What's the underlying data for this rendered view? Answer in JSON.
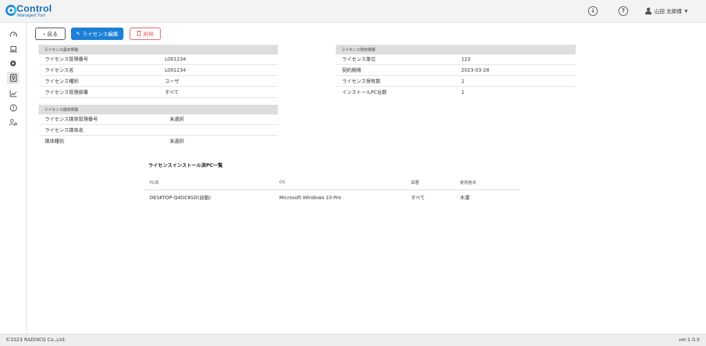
{
  "header": {
    "logo_title": "Control",
    "logo_subtitle": "Managed Tool",
    "user_name": "山田 太郎様"
  },
  "toolbar": {
    "back_label": "戻る",
    "edit_label": "ライセンス編集",
    "delete_label": "削除"
  },
  "license_basic": {
    "title": "ライセンス基本情報",
    "rows": [
      {
        "label": "ライセンス管理番号",
        "value": "L001234"
      },
      {
        "label": "ライセンス名",
        "value": "L001234"
      },
      {
        "label": "ライセンス種別",
        "value": "ユーザ"
      },
      {
        "label": "ライセンス管理部署",
        "value": "すべて"
      }
    ]
  },
  "license_contract": {
    "title": "ライセンス契約情報",
    "rows": [
      {
        "label": "ライセンス単位",
        "value": "123"
      },
      {
        "label": "契約期限",
        "value": "2023-03-28"
      },
      {
        "label": "ライセンス保有数",
        "value": "1"
      },
      {
        "label": "インストールPC台数",
        "value": "1"
      }
    ]
  },
  "license_media": {
    "title": "ライセンス媒体情報",
    "rows": [
      {
        "label": "ライセンス媒体管理番号",
        "value": "未選択"
      },
      {
        "label": "ライセンス媒体名",
        "value": ""
      },
      {
        "label": "媒体種別",
        "value": "未選択"
      }
    ]
  },
  "installed_list": {
    "title": "ライセンスインストール済PC一覧",
    "columns": [
      "PC名",
      "OS",
      "部署",
      "使用者名"
    ],
    "rows": [
      [
        "DESKTOP-Q4DC8SD(自動)",
        "Microsoft Windows 10 Pro",
        "すべて",
        "木濃"
      ]
    ]
  },
  "footer": {
    "copyright": "©2023 RADIXCG Co.,Ltd.",
    "version": "ver.1.0.0"
  }
}
